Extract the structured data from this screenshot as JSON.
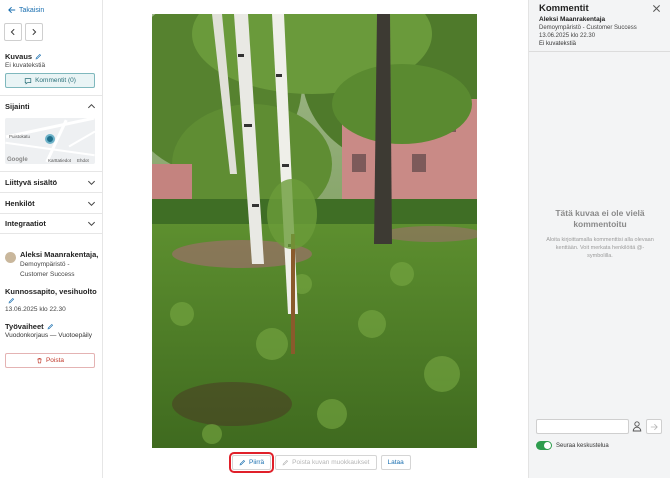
{
  "nav": {
    "back_label": "Takaisin"
  },
  "description": {
    "title": "Kuvaus",
    "value": "Ei kuvatekstiä",
    "comments_button": "Kommentit (0)"
  },
  "sections": {
    "location": "Sijainti",
    "attached": "Liittyvä sisältö",
    "persons": "Henkilöt",
    "integrations": "Integraatiot"
  },
  "map": {
    "road_label_1": "Puistokatu",
    "road_label_2": "Kartta",
    "attribution": "Google",
    "terms": "Karttatiedot",
    "legal": "Ehdot"
  },
  "author": {
    "name": "Aleksi Maanrakentaja,",
    "org_line1": "Demoympäristö -",
    "org_line2": "Customer Success"
  },
  "project": {
    "title": "Kunnossapito, vesihuolto",
    "date": "13.06.2025 klo 22.30"
  },
  "work": {
    "title": "Työvaiheet",
    "value": "Vuodonkorjaus — Vuotoepäily"
  },
  "delete_label": "Poista",
  "toolbar": {
    "draw": "Piirrä",
    "remove_edits": "Poista kuvan muokkaukset",
    "download": "Lataa"
  },
  "comments_panel": {
    "title": "Kommentit",
    "author": "Aleksi Maanrakentaja",
    "org": "Demoympäristö - Customer Success",
    "date": "13.06.2025 klo 22.30",
    "description": "Ei kuvatekstiä",
    "empty_title": "Tätä kuvaa ei ole vielä kommentoitu",
    "empty_sub": "Aloita kirjoittamalla kommenttisi alla olevaan kenttään. Voit merkata henkilöitä @-symbolilla.",
    "input_placeholder": "",
    "follow_label": "Seuraa keskustelua",
    "follow_on": true
  },
  "colors": {
    "accent": "#1a6fb0",
    "teal": "#2a6f78",
    "danger": "#c0392b",
    "toggle": "#2e9d4e",
    "highlight": "#e0202a"
  }
}
